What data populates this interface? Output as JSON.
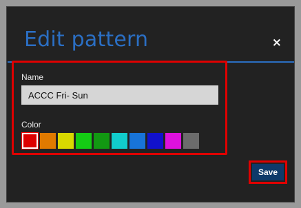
{
  "dialog": {
    "title": "Edit pattern",
    "close_glyph": "×"
  },
  "form": {
    "name_label": "Name",
    "name_value": "ACCC Fri- Sun",
    "color_label": "Color",
    "swatches": [
      {
        "name": "red",
        "hex": "#dd0000",
        "selected": true
      },
      {
        "name": "orange",
        "hex": "#e07a00"
      },
      {
        "name": "yellow",
        "hex": "#d8d800"
      },
      {
        "name": "green",
        "hex": "#14cc14"
      },
      {
        "name": "dark-green",
        "hex": "#129812"
      },
      {
        "name": "cyan",
        "hex": "#11cccc"
      },
      {
        "name": "blue",
        "hex": "#1874d8"
      },
      {
        "name": "dark-blue",
        "hex": "#1111cc"
      },
      {
        "name": "magenta",
        "hex": "#dd11dd"
      },
      {
        "name": "gray",
        "hex": "#6c6c6c"
      }
    ]
  },
  "actions": {
    "save_label": "Save"
  },
  "colors": {
    "title_blue": "#2b6fc4",
    "dialog_bg": "#222222",
    "highlight_red": "#e00000",
    "save_bg": "#0e3a6a"
  }
}
